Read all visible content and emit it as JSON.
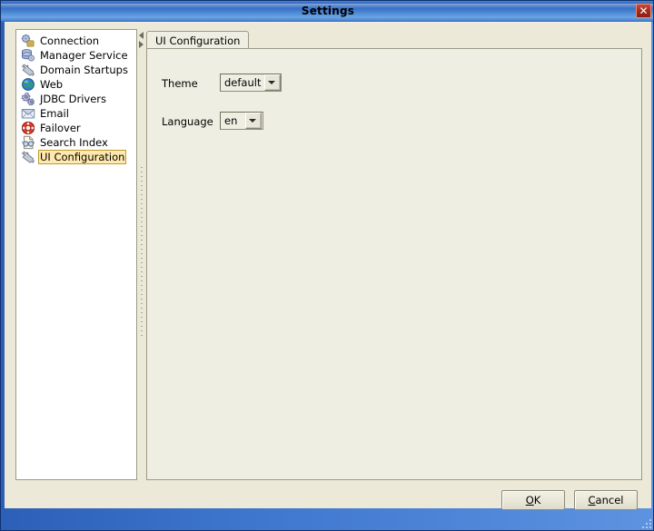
{
  "window": {
    "title": "Settings",
    "close_icon": "close-icon",
    "close_glyph": "✕",
    "titlebar_color": "#3f77cf",
    "client_color": "#ece9d8"
  },
  "tree": {
    "items": [
      {
        "label": "Connection",
        "icon": "connection-icon",
        "selected": false
      },
      {
        "label": "Manager Service",
        "icon": "manager-service-icon",
        "selected": false
      },
      {
        "label": "Domain Startups",
        "icon": "wrench-icon",
        "selected": false
      },
      {
        "label": "Web",
        "icon": "globe-icon",
        "selected": false
      },
      {
        "label": "JDBC Drivers",
        "icon": "gears-icon",
        "selected": false
      },
      {
        "label": "Email",
        "icon": "envelope-icon",
        "selected": false
      },
      {
        "label": "Failover",
        "icon": "lifebuoy-icon",
        "selected": false
      },
      {
        "label": "Search Index",
        "icon": "document-search-icon",
        "selected": false
      },
      {
        "label": "UI Configuration",
        "icon": "wrench-icon",
        "selected": true
      }
    ],
    "selection_bg": "#ffe9ae",
    "selection_border": "#c09a2e"
  },
  "divider": {
    "collapse_left_icon": "triangle-left-icon",
    "collapse_right_icon": "triangle-right-icon",
    "grip_icon": "split-grip-icon"
  },
  "tabs": [
    {
      "label": "UI Configuration",
      "selected": true
    }
  ],
  "form": {
    "theme": {
      "label": "Theme",
      "value": "default",
      "arrow_icon": "chevron-down-icon"
    },
    "language": {
      "label": "Language",
      "value": "en",
      "arrow_icon": "chevron-down-icon"
    }
  },
  "buttons": {
    "ok": {
      "mnemonic": "O",
      "rest": "K"
    },
    "cancel": {
      "pre": "",
      "mnemonic": "C",
      "rest": "ancel"
    }
  }
}
